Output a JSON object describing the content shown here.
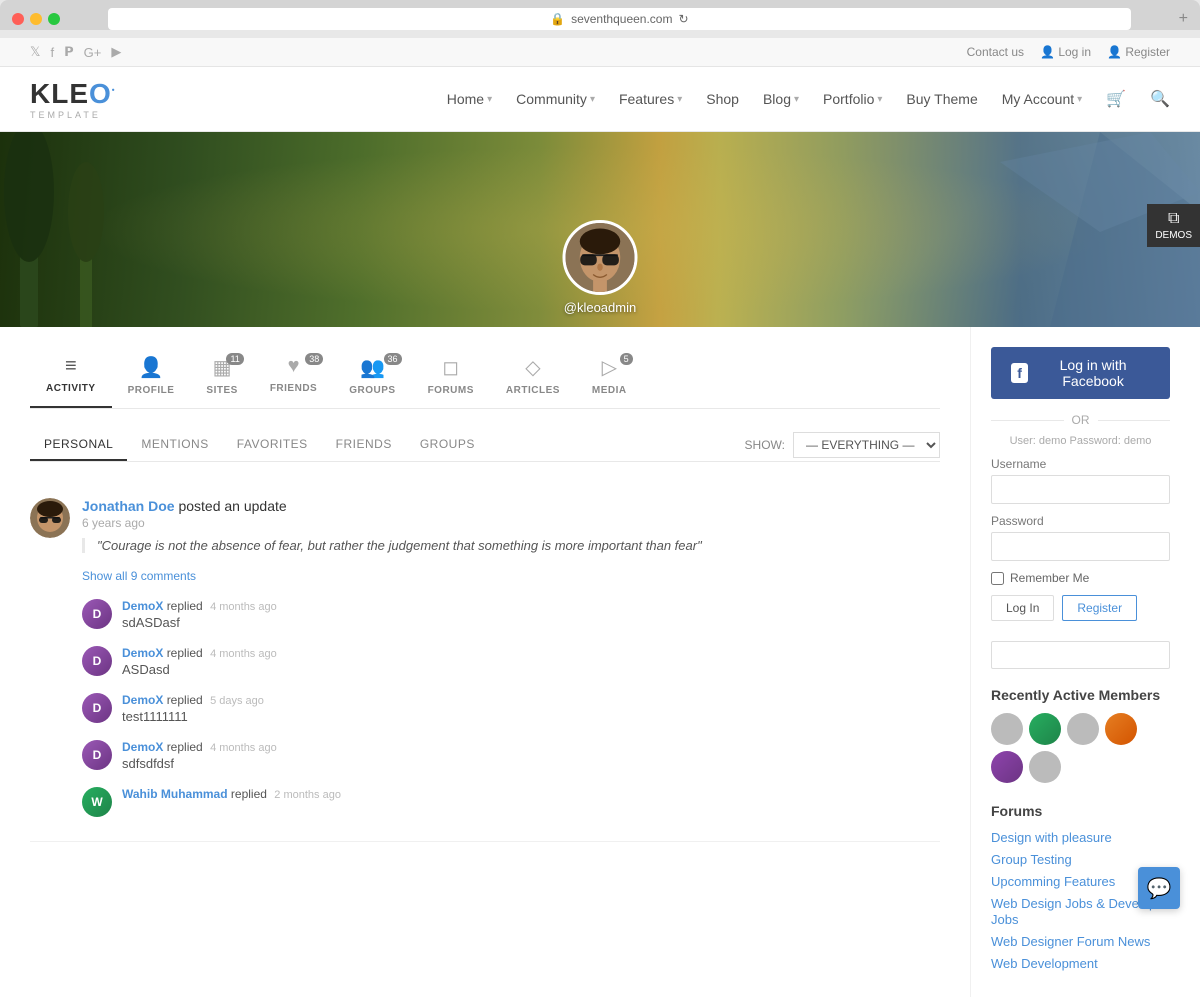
{
  "browser": {
    "url": "seventhqueen.com",
    "tab_label": "seventhqueen.com"
  },
  "topbar": {
    "contact_us": "Contact us",
    "log_in": "Log in",
    "register": "Register"
  },
  "logo": {
    "text": "KLEO",
    "dot_color": "#4a90d9",
    "subtitle": "TEMPLATE"
  },
  "nav": {
    "items": [
      {
        "label": "Home",
        "has_dropdown": true
      },
      {
        "label": "Community",
        "has_dropdown": true
      },
      {
        "label": "Features",
        "has_dropdown": true
      },
      {
        "label": "Shop",
        "has_dropdown": false
      },
      {
        "label": "Blog",
        "has_dropdown": true
      },
      {
        "label": "Portfolio",
        "has_dropdown": true
      },
      {
        "label": "Buy Theme",
        "has_dropdown": false
      },
      {
        "label": "My Account",
        "has_dropdown": true
      }
    ]
  },
  "hero": {
    "username": "@kleoadmin"
  },
  "profile_tabs": [
    {
      "id": "activity",
      "label": "ACTIVITY",
      "icon": "≡",
      "count": null,
      "active": true
    },
    {
      "id": "profile",
      "label": "PROFILE",
      "icon": "👤",
      "count": null,
      "active": false
    },
    {
      "id": "sites",
      "label": "SITES",
      "icon": "▦",
      "count": "11",
      "active": false
    },
    {
      "id": "friends",
      "label": "FRIENDS",
      "icon": "♥",
      "count": "38",
      "active": false
    },
    {
      "id": "groups",
      "label": "GROUPS",
      "icon": "👥",
      "count": "36",
      "active": false
    },
    {
      "id": "forums",
      "label": "FORUMS",
      "icon": "□",
      "count": null,
      "active": false
    },
    {
      "id": "articles",
      "label": "ARTICLES",
      "icon": "◇",
      "count": null,
      "active": false
    },
    {
      "id": "media",
      "label": "MEDIA",
      "icon": "▷",
      "count": "5",
      "active": false
    }
  ],
  "activity_filters": {
    "tabs": [
      {
        "label": "PERSONAL",
        "active": true
      },
      {
        "label": "MENTIONS",
        "active": false
      },
      {
        "label": "FAVORITES",
        "active": false
      },
      {
        "label": "FRIENDS",
        "active": false
      },
      {
        "label": "GROUPS",
        "active": false
      }
    ],
    "show_label": "SHOW:",
    "show_value": "— EVERYTHING —"
  },
  "activity_items": [
    {
      "user": "Jonathan Doe",
      "action": "posted an update",
      "time": "6 years ago",
      "quote": "\"Courage is not the absence of fear, but rather the judgement that something is more important than fear\"",
      "show_comments": "Show all 9 comments",
      "comments": [
        {
          "user": "DemoX",
          "action": "replied",
          "time": "4 months ago",
          "text": "sdASDasf"
        },
        {
          "user": "DemoX",
          "action": "replied",
          "time": "4 months ago",
          "text": "ASDasd"
        },
        {
          "user": "DemoX",
          "action": "replied",
          "time": "5 days ago",
          "text": "test1111111"
        },
        {
          "user": "DemoX",
          "action": "replied",
          "time": "4 months ago",
          "text": "sdfsdfdsf"
        },
        {
          "user": "Wahib Muhammad",
          "action": "replied",
          "time": "2 months ago",
          "text": ""
        }
      ]
    }
  ],
  "sidebar": {
    "fb_login_label": "Log in with Facebook",
    "or_text": "OR",
    "demo_note": "User: demo Password: demo",
    "username_label": "Username",
    "password_label": "Password",
    "remember_me_label": "Remember Me",
    "login_btn": "Log In",
    "register_btn": "Register",
    "recently_active_title": "Recently Active Members",
    "forums_title": "Forums",
    "forum_links": [
      "Design with pleasure",
      "Group Testing",
      "Upcomming Features",
      "Web Design Jobs & Developer Jobs",
      "Web Designer Forum News",
      "Web Development"
    ]
  },
  "demos_badge": {
    "label": "DEMOS"
  }
}
